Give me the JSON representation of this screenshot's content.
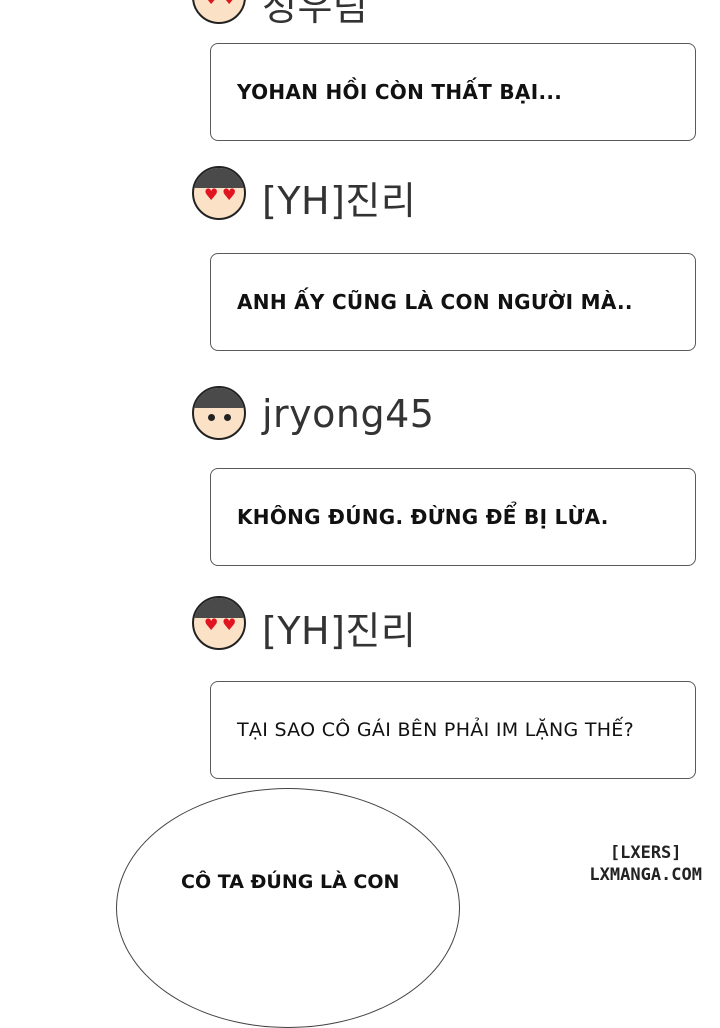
{
  "top_username": "정우림",
  "messages": [
    {
      "username": "",
      "avatar": "hearts",
      "text": "YOHAN HỒI CÒN THẤT BẠI..."
    },
    {
      "username": "[YH]진리",
      "avatar": "hearts",
      "text": "ANH ẤY CŨNG LÀ CON NGƯỜI MÀ.."
    },
    {
      "username": "jryong45",
      "avatar": "normal",
      "text": "KHÔNG ĐÚNG. ĐỪNG ĐỂ BỊ LỪA."
    },
    {
      "username": "[YH]진리",
      "avatar": "hearts",
      "text": "TẠI SAO CÔ GÁI BÊN PHẢI IM LẶNG THẾ?"
    }
  ],
  "speech_bubble": {
    "text": "CÔ TA ĐÚNG LÀ CON"
  },
  "watermark": {
    "line1": "[LXERS]",
    "line2": "LXMANGA.COM"
  },
  "colors": {
    "heart": "#e0151f",
    "hair": "#4a4a4a",
    "skin": "#fbe2c6"
  }
}
